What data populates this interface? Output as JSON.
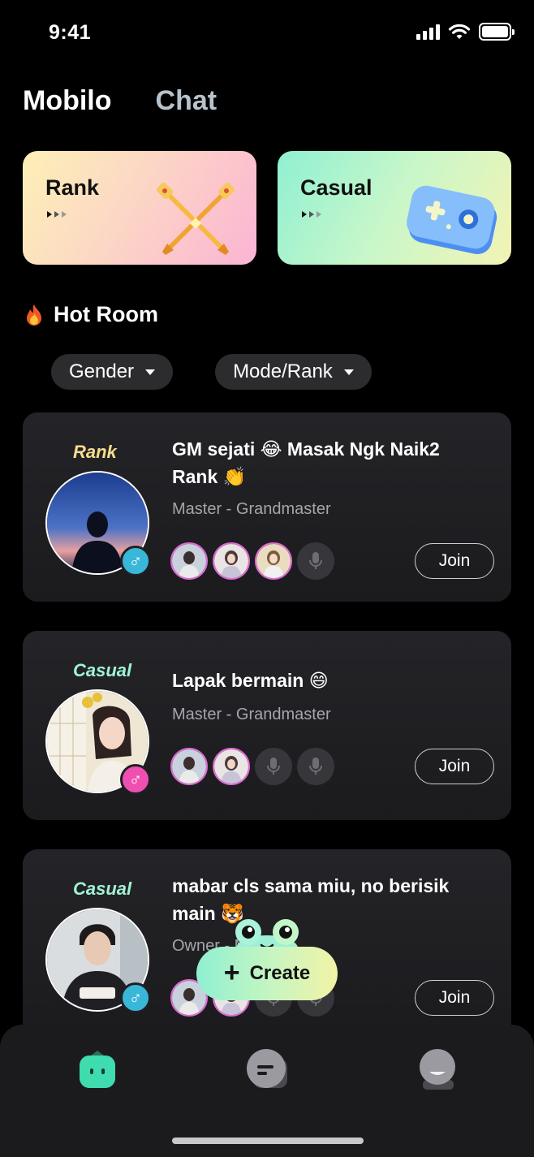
{
  "status_bar": {
    "time": "9:41"
  },
  "top_tabs": [
    {
      "label": "Mobilo",
      "active": true
    },
    {
      "label": "Chat",
      "active": false
    }
  ],
  "modes": [
    {
      "label": "Rank"
    },
    {
      "label": "Casual"
    }
  ],
  "hot_room": {
    "title": "Hot Room",
    "icon": "fire-icon"
  },
  "filters": [
    {
      "label": "Gender"
    },
    {
      "label": "Mode/Rank"
    }
  ],
  "rooms": [
    {
      "mode": "Rank",
      "title": "GM sejati 😂 Masak Ngk Naik2 Rank 👏",
      "subtitle": "Master - Grandmaster",
      "gender_symbol": "♂",
      "join_label": "Join"
    },
    {
      "mode": "Casual",
      "title": "Lapak bermain 😄",
      "subtitle": "Master - Grandmaster",
      "gender_symbol": "♂",
      "join_label": "Join"
    },
    {
      "mode": "Casual",
      "title": "mabar cls sama miu, no berisik main 🐯",
      "subtitle": "Owner - Master",
      "gender_symbol": "♂",
      "join_label": "Join"
    }
  ],
  "create_button": {
    "label": "Create"
  },
  "bottom_nav": [
    {
      "icon": "robot-home-icon",
      "active": true
    },
    {
      "icon": "chat-icon",
      "active": false
    },
    {
      "icon": "profile-icon",
      "active": false
    }
  ],
  "colors": {
    "accent_mint": "#8ff0d2",
    "accent_yellow": "#f3f3a6",
    "rank_gold": "#f7dd8d",
    "casual_mint": "#9ff3d2"
  }
}
